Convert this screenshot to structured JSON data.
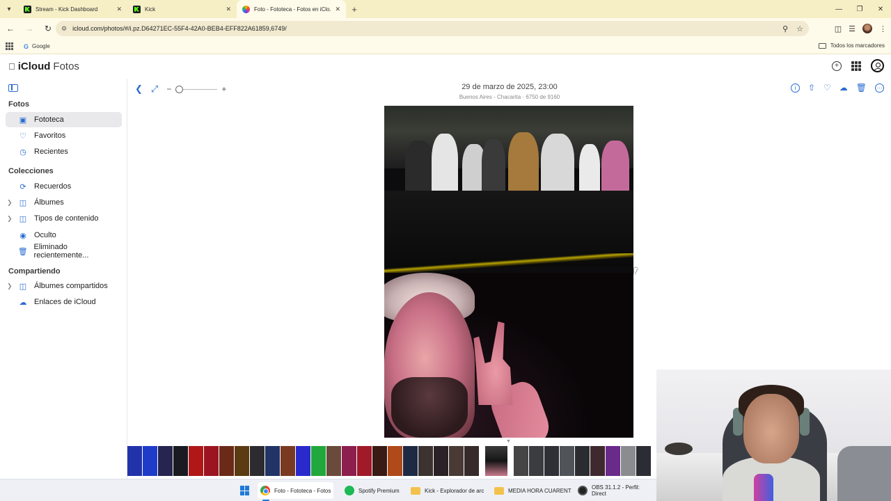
{
  "browser": {
    "tabs": [
      {
        "title": "Stream - Kick Dashboard",
        "icon": "kick-icon",
        "active": false
      },
      {
        "title": "Kick",
        "icon": "kick-icon",
        "active": false
      },
      {
        "title": "Foto - Fototeca - Fotos en iClo...",
        "icon": "photos-icon",
        "active": true
      }
    ],
    "url": "icloud.com/photos/#/i.pz.D64271EC-55F4-42A0-BEB4-EFF822A61859,6749/",
    "bookmarks": [
      {
        "label": "Google"
      }
    ],
    "all_bookmarks_label": "Todos los marcadores"
  },
  "header": {
    "brand": "iCloud",
    "app": "Fotos"
  },
  "sidebar": {
    "sections": [
      {
        "title": "Fotos"
      },
      {
        "title": "Colecciones"
      },
      {
        "title": "Compartiendo"
      }
    ],
    "items": [
      {
        "label": "Fototeca",
        "icon": "library-icon",
        "selected": true
      },
      {
        "label": "Favoritos",
        "icon": "heart-icon"
      },
      {
        "label": "Recientes",
        "icon": "clock-icon"
      },
      {
        "label": "Recuerdos",
        "icon": "memories-icon"
      },
      {
        "label": "Álbumes",
        "icon": "album-icon",
        "expandable": true
      },
      {
        "label": "Tipos de contenido",
        "icon": "media-types-icon",
        "expandable": true
      },
      {
        "label": "Oculto",
        "icon": "eye-slash-icon"
      },
      {
        "label": "Eliminado recientemente...",
        "icon": "trash-icon"
      },
      {
        "label": "Álbumes compartidos",
        "icon": "shared-album-icon",
        "expandable": true
      },
      {
        "label": "Enlaces de iCloud",
        "icon": "cloud-link-icon"
      }
    ]
  },
  "viewer": {
    "date": "29 de marzo de 2025, 23:00",
    "subtitle": "Buenos Aires - Chacarita · 6750 de 9160",
    "zoom": 0
  },
  "taskbar": {
    "items": [
      {
        "label": "Foto - Fototeca - Fotos",
        "icon": "chrome-icon",
        "active": true
      },
      {
        "label": "Spotify Premium",
        "icon": "spotify-icon"
      },
      {
        "label": "Kick - Explorador de arc",
        "icon": "folder-icon"
      },
      {
        "label": "MEDIA HORA CUARENT",
        "icon": "folder-icon"
      },
      {
        "label": "OBS 31.1.2 - Perfil: Direct",
        "icon": "obs-icon"
      }
    ]
  },
  "colors": {
    "accent": "#2a6ccf",
    "tabstrip": "#f6efc6",
    "toolbar": "#fffbea"
  }
}
